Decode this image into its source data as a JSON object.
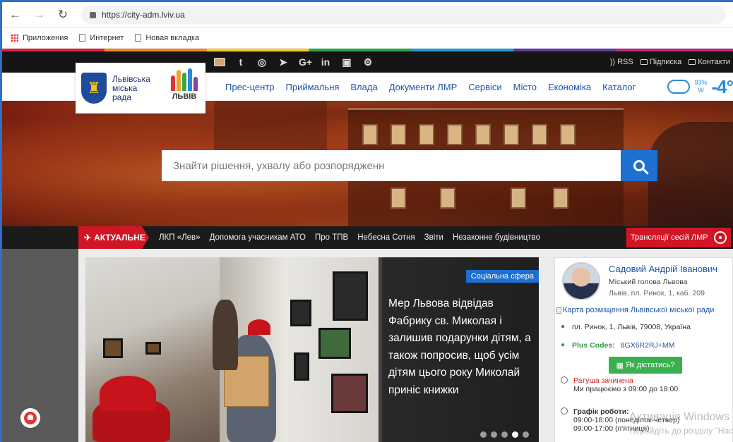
{
  "browser": {
    "url": "https://city-adm.lviv.ua",
    "bookmarks": [
      "Приложения",
      "Интернет",
      "Новая вкладка"
    ]
  },
  "topbar": {
    "rss": "RSS",
    "subscribe": "Підписка",
    "contacts": "Контакти"
  },
  "logo": {
    "text": "Львівська міська рада",
    "brand": "ЛЬВІВ"
  },
  "menu": [
    "Прес-центр",
    "Приймальня",
    "Влада",
    "Документи ЛМР",
    "Сервіси",
    "Місто",
    "Економіка",
    "Каталог"
  ],
  "weather": {
    "humidity": "93%",
    "wind": "W",
    "temp": "-4°"
  },
  "search": {
    "placeholder": "Знайти рішення, ухвалу або розпорядженн"
  },
  "strip": {
    "aktual": "АКТУАЛЬНЕ",
    "links": [
      "ЛКП «Лев»",
      "Допомога учасникам АТО",
      "Про ТПВ",
      "Небесна Сотня",
      "Звіти",
      "Незаконне будівництво"
    ],
    "broadcast": "Трансляції сесій ЛМР"
  },
  "slide": {
    "category": "Соціальна сфера",
    "headline": "Мер Львова відвідав Фабрику св. Миколая і залишив подарунки дітям, а також попросив, щоб усім дітям цього року Миколай приніс книжки",
    "dots": 5,
    "active_dot": 4
  },
  "mayor": {
    "name": "Садовий Андрій Іванович",
    "role": "Міський голова Львова",
    "address": "Львів, пл. Ринок, 1, каб. 209",
    "map_alt": "Карта розміщення Львівської міської ради",
    "location": "пл. Ринок, 1, Львів, 79008, Україна",
    "plus_label": "Plus Codes:",
    "plus_code": "8GX6R2RJ+MM",
    "route_btn": "Як дістатись?",
    "status": "Ратуша зачинена",
    "hours_note": "Ми працюємо з 09:00 до 18:00",
    "schedule_label": "Графік роботи:",
    "schedule_1": "09:00-18:00 (понеділок-четвер)",
    "schedule_2": "09:00-17:00 (п'ятниця)"
  },
  "watermark": {
    "line1": "Активація Windows",
    "line2": "Перейдіть до розділу \"Настр"
  }
}
